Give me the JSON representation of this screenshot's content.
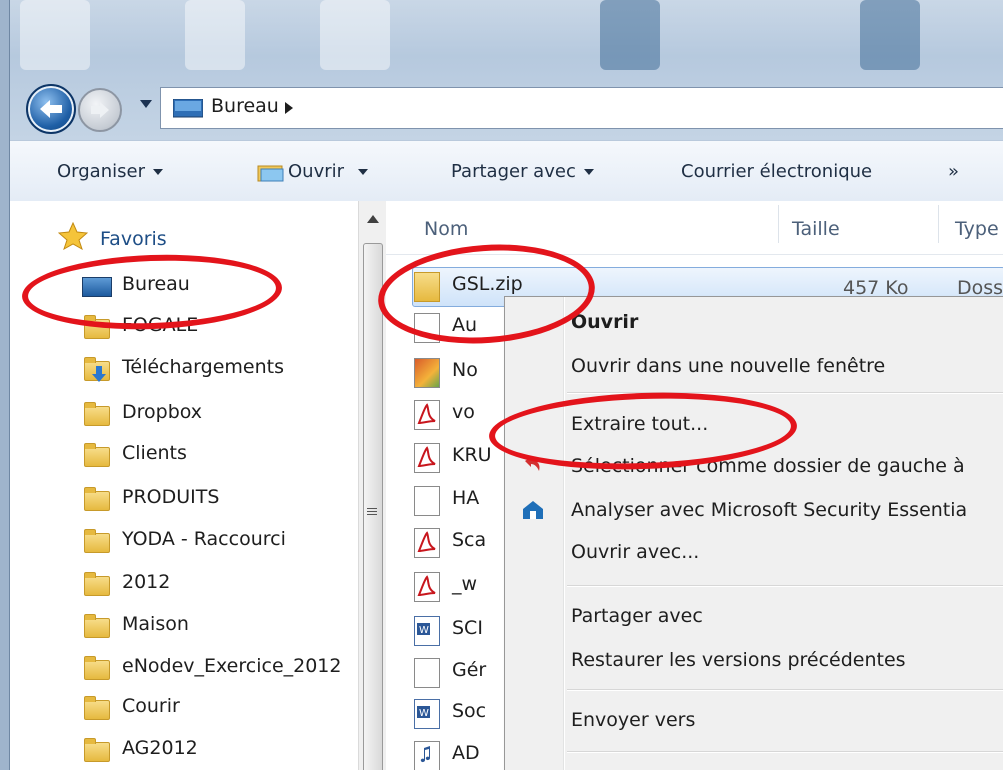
{
  "address_bar": {
    "crumb": "Bureau"
  },
  "command_bar": {
    "organise": "Organiser",
    "open": "Ouvrir",
    "share": "Partager avec",
    "email": "Courrier électronique",
    "more": "»"
  },
  "nav_pane": {
    "favorites_label": "Favoris",
    "items": [
      {
        "label": "Bureau",
        "icon": "desktop-icon"
      },
      {
        "label": "FOGALE",
        "icon": "folder-icon"
      },
      {
        "label": "Téléchargements",
        "icon": "downloads-folder-icon"
      },
      {
        "label": "Dropbox",
        "icon": "folder-icon"
      },
      {
        "label": "Clients",
        "icon": "folder-icon"
      },
      {
        "label": "PRODUITS",
        "icon": "folder-icon"
      },
      {
        "label": "YODA - Raccourci",
        "icon": "folder-icon"
      },
      {
        "label": "2012",
        "icon": "folder-icon"
      },
      {
        "label": "Maison",
        "icon": "folder-icon"
      },
      {
        "label": "eNodev_Exercice_2012",
        "icon": "folder-icon"
      },
      {
        "label": "Courir",
        "icon": "folder-icon"
      },
      {
        "label": "AG2012",
        "icon": "folder-icon"
      }
    ]
  },
  "file_list": {
    "columns": [
      "Nom",
      "Taille",
      "Type"
    ],
    "selected": {
      "name": "GSL.zip",
      "size": "457 Ko",
      "type": "Doss"
    },
    "rows": [
      {
        "name": "Au",
        "icon": "document-icon"
      },
      {
        "name": "No",
        "icon": "image-icon"
      },
      {
        "name": "vo",
        "icon": "pdf-icon"
      },
      {
        "name": "KRU",
        "icon": "pdf-icon"
      },
      {
        "name": "HA",
        "icon": "document-icon"
      },
      {
        "name": "Sca",
        "icon": "pdf-icon"
      },
      {
        "name": "_w",
        "icon": "pdf-icon"
      },
      {
        "name": "SCI",
        "icon": "word-icon"
      },
      {
        "name": "Gér",
        "icon": "document-icon"
      },
      {
        "name": "Soc",
        "icon": "word-icon"
      },
      {
        "name": "AD",
        "icon": "audio-icon"
      }
    ]
  },
  "context_menu": {
    "items": [
      {
        "label": "Ouvrir",
        "bold": true
      },
      {
        "label": "Ouvrir dans une nouvelle fenêtre"
      },
      {
        "label": "Extraire tout..."
      },
      {
        "label": "Sélectionner comme dossier de gauche à"
      },
      {
        "label": "Analyser avec Microsoft Security Essentia"
      },
      {
        "label": "Ouvrir avec..."
      },
      {
        "label": "Partager avec"
      },
      {
        "label": "Restaurer les versions précédentes"
      },
      {
        "label": "Envoyer vers"
      }
    ]
  },
  "colors": {
    "annotation_red": "#e3141b",
    "selection": "#cfe3f9"
  }
}
